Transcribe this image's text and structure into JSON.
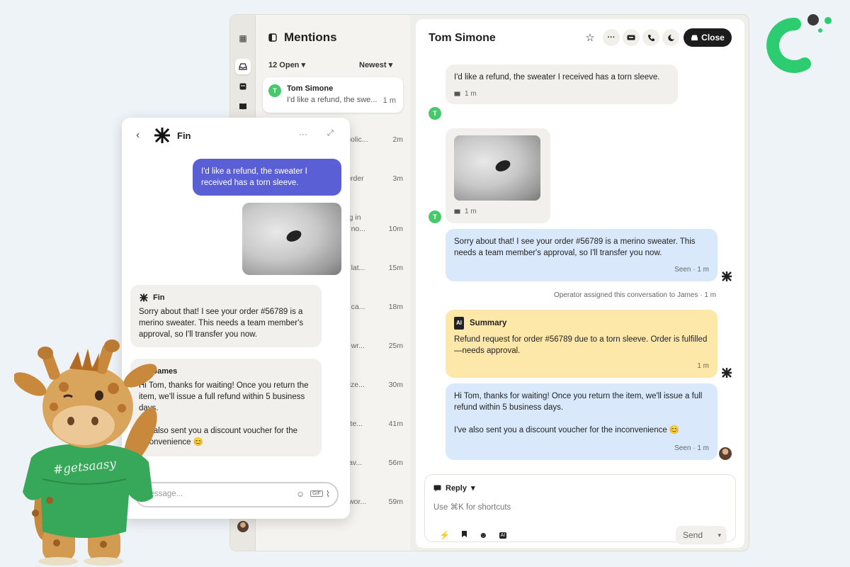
{
  "inbox": {
    "header": "Mentions",
    "open_filter": "12 Open",
    "sort": "Newest",
    "active_card": {
      "avatar": "T",
      "name": "Tom Simone",
      "preview": "I'd like a refund, the swe...",
      "time": "1 m"
    },
    "rows": [
      {
        "preview": "s polic...",
        "time": "2m"
      },
      {
        "preview": "y order",
        "time": "3m"
      },
      {
        "preview": "bug in",
        "preview2": "en no...",
        "time": "10m"
      },
      {
        "preview": "he lat...",
        "time": "15m"
      },
      {
        "preview": "? I ca...",
        "time": "18m"
      },
      {
        "preview": "he wr...",
        "time": "25m"
      },
      {
        "preview": "r size...",
        "time": "30m"
      },
      {
        "preview": "in ite...",
        "time": "41m"
      },
      {
        "preview": "ts av...",
        "time": "56m"
      },
      {
        "preview": "st wor...",
        "time": "59m"
      }
    ]
  },
  "conversation": {
    "title": "Tom Simone",
    "close_label": "Close",
    "customer_avatar": "T",
    "msg1": "I'd like a refund, the sweater I received has a torn sleeve.",
    "msg1_time": "1 m",
    "photo_time": "1 m",
    "fin_msg": "Sorry about that! I see your order #56789 is a merino sweater. This needs a team member's approval, so I'll transfer you now.",
    "fin_status": "Seen · 1 m",
    "event": "Operator assigned this conversation to James · 1 m",
    "summary_badge": "AI",
    "summary_title": "Summary",
    "summary_text": "Refund request for order #56789 due to a torn sleeve. Order is fulfilled—needs approval.",
    "summary_time": "1 m",
    "james_msg1": "Hi Tom, thanks for waiting! Once you return the item, we'll issue a full refund within 5 business days.",
    "james_msg2": "I've also sent you a discount voucher for the inconvenience 😊",
    "james_status": "Seen · 1 m",
    "reply_label": "Reply",
    "reply_placeholder": "Use ⌘K for shortcuts",
    "send_label": "Send"
  },
  "widget": {
    "title": "Fin",
    "user_msg": "I'd like a refund, the sweater I received has a torn sleeve.",
    "fin_name": "Fin",
    "fin_msg": "Sorry about that! I see your order #56789 is a merino sweater. This needs a team member's approval, so I'll transfer you now.",
    "james_name": "James",
    "james_msg1": "Hi Tom, thanks for waiting! Once you return the item, we'll issue a full refund within 5 business days.",
    "james_msg2": "I've also sent you a discount voucher for the inconvenience 😊",
    "message_placeholder": "Message..."
  },
  "mascot": {
    "shirt_text": "#getsaasy"
  },
  "colors": {
    "user_bubble": "#5b5fd6",
    "fin_bubble": "#d9e9fb",
    "summary": "#fde8a9",
    "brand_green": "#2ecc71",
    "avatar_green": "#48c86a"
  },
  "icons": [
    "inbox-icon",
    "knowledge-icon",
    "book-icon",
    "sidebar-icon",
    "star-icon",
    "more-icon",
    "ticket-icon",
    "phone-icon",
    "snooze-icon",
    "send-chevron-icon",
    "bolt-icon",
    "bookmark-icon",
    "emoji-icon",
    "ai-icon",
    "gif-icon",
    "attach-icon",
    "back-icon",
    "expand-icon"
  ]
}
